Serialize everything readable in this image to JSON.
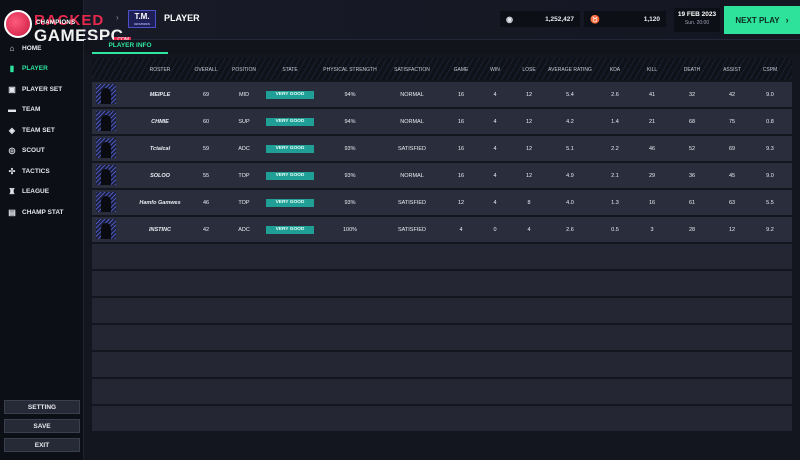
{
  "logo": {
    "line1_colored": "RACKED",
    "line1_dim": "",
    "tag": "CHAMPIONS",
    "line2": "GAMESPC",
    "com": ".COM"
  },
  "sidebar": {
    "items": [
      {
        "label": "HOME",
        "icon": "home-icon",
        "active": false
      },
      {
        "label": "PLAYER",
        "icon": "player-icon",
        "active": true
      },
      {
        "label": "PLAYER SET",
        "icon": "player-set-icon",
        "active": false
      },
      {
        "label": "TEAM",
        "icon": "team-icon",
        "active": false
      },
      {
        "label": "TEAM SET",
        "icon": "team-set-icon",
        "active": false
      },
      {
        "label": "SCOUT",
        "icon": "binoculars-icon",
        "active": false
      },
      {
        "label": "TACTICS",
        "icon": "tactics-icon",
        "active": false
      },
      {
        "label": "LEAGUE",
        "icon": "trophy-icon",
        "active": false
      },
      {
        "label": "CHAMP STAT",
        "icon": "clipboard-icon",
        "active": false
      }
    ],
    "buttons": {
      "setting": "SETTING",
      "save": "SAVE",
      "exit": "EXIT"
    }
  },
  "header": {
    "team_logo": "T.M.",
    "team_logo_sub": "GRAPHICS",
    "title": "PLAYER",
    "money": "1,252,427",
    "fans": "1,120",
    "date": "19 FEB 2023",
    "day_time": "Sun. 20:00",
    "next_play": "NEXT PLAY"
  },
  "tab": {
    "label": "PLAYER INFO"
  },
  "table": {
    "columns": [
      "ROSTER",
      "OVERALL",
      "POSITION",
      "STATE",
      "PHYSICAL STRENGTH",
      "SATISFACTION",
      "GAME",
      "WIN",
      "LOSE",
      "AVERAGE RATING",
      "KDA",
      "KILL",
      "DEATH",
      "ASSIST",
      "CSPM"
    ],
    "rows": [
      [
        "MEIPLE",
        "69",
        "MID",
        "VERY GOOD",
        "94%",
        "NORMAL",
        "16",
        "4",
        "12",
        "5.4",
        "2.6",
        "41",
        "32",
        "42",
        "9.0"
      ],
      [
        "CHMIE",
        "60",
        "SUP",
        "VERY GOOD",
        "94%",
        "NORMAL",
        "16",
        "4",
        "12",
        "4.2",
        "1.4",
        "21",
        "68",
        "75",
        "0.8"
      ],
      [
        "Tctalcal",
        "59",
        "ADC",
        "VERY GOOD",
        "93%",
        "SATISFIED",
        "16",
        "4",
        "12",
        "5.1",
        "2.2",
        "46",
        "52",
        "69",
        "9.3"
      ],
      [
        "SOLOO",
        "55",
        "TOP",
        "VERY GOOD",
        "93%",
        "NORMAL",
        "16",
        "4",
        "12",
        "4.9",
        "2.1",
        "29",
        "36",
        "45",
        "9.0"
      ],
      [
        "Hamfo Gamwes",
        "46",
        "TOP",
        "VERY GOOD",
        "93%",
        "SATISFIED",
        "12",
        "4",
        "8",
        "4.0",
        "1.3",
        "16",
        "61",
        "63",
        "5.5"
      ],
      [
        "INSTINC",
        "42",
        "ADC",
        "VERY GOOD",
        "100%",
        "SATISFIED",
        "4",
        "0",
        "4",
        "2.6",
        "0.5",
        "3",
        "28",
        "12",
        "9.2"
      ]
    ],
    "empty_rows": 7
  },
  "colors": {
    "accent": "#2ee6a0",
    "badge": "#1f9f95",
    "brand_red": "#e8294e"
  }
}
